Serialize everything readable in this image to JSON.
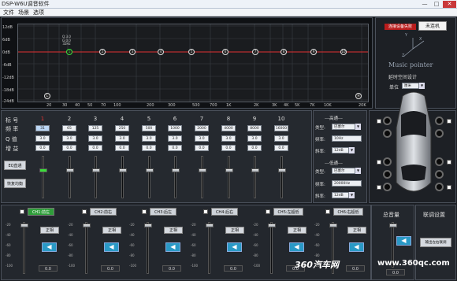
{
  "window": {
    "title": "DSP-W6U调音软件",
    "min": "—",
    "max": "□",
    "close": "✕"
  },
  "menu": [
    "文件",
    "场景",
    "选项"
  ],
  "eq": {
    "y_labels": [
      "12dB",
      "6dB",
      "0dB",
      "-6dB",
      "-12dB",
      "-18dB",
      "-24dB"
    ],
    "x_labels": [
      "20",
      "30",
      "40",
      "50",
      "70",
      "100",
      "200",
      "300",
      "500",
      "700",
      "1K",
      "2K",
      "3K",
      "4K",
      "5K",
      "7K",
      "10K",
      "20K"
    ],
    "bands": [
      "1",
      "2",
      "3",
      "4",
      "5",
      "6",
      "7",
      "8",
      "9",
      "10"
    ],
    "selected_band": "1",
    "info": [
      "Q:3.0",
      "G:0.0",
      "32Hz"
    ],
    "left_node": "L",
    "right_node": "H",
    "curve_color": "#e03030"
  },
  "right": {
    "disconnected": "连接设备失败",
    "not_connected": "未连机",
    "brand": "Music pointer",
    "delay_design": "延时空间设计",
    "unit_label": "单位",
    "unit_value": "厘米",
    "axes": {
      "x": "X",
      "y": "Y",
      "z": "Z"
    }
  },
  "ctrl": {
    "row_labels": [
      "标 号",
      "频 率",
      "Q 值",
      "增 益"
    ],
    "freqs": [
      "31",
      "65",
      "125",
      "250",
      "500",
      "1000",
      "2000",
      "4000",
      "8000",
      "16000"
    ],
    "q": [
      "3.0",
      "3.0",
      "3.0",
      "3.0",
      "3.0",
      "3.0",
      "3.0",
      "3.0",
      "3.0",
      "3.0"
    ],
    "gain": [
      "0.0",
      "0.0",
      "0.0",
      "0.0",
      "0.0",
      "0.0",
      "0.0",
      "0.0",
      "0.0",
      "0.0"
    ],
    "btn_bypass": "EQ直通",
    "btn_reset": "恢复均衡"
  },
  "filter": {
    "high_title": "---高通---",
    "low_title": "---低通---",
    "type_label": "类型:",
    "freq_label": "频率:",
    "slope_label": "斜率:",
    "high_type": "巴塞尔",
    "high_freq": "10Hz",
    "high_slope": "12dB",
    "low_type": "巴塞尔",
    "low_freq": "20000Hz",
    "low_slope": "12dB"
  },
  "channels": [
    {
      "label": "CH1:前左",
      "active": true,
      "group": "正相",
      "value": "0.0"
    },
    {
      "label": "CH2:前右",
      "active": false,
      "group": "正相",
      "value": "0.0"
    },
    {
      "label": "CH3:后左",
      "active": false,
      "group": "正相",
      "value": "0.0"
    },
    {
      "label": "CH4:后右",
      "active": false,
      "group": "正相",
      "value": "0.0"
    },
    {
      "label": "CH5:左超低",
      "active": false,
      "group": "正相",
      "value": "0.0"
    },
    {
      "label": "CH6:右超低",
      "active": false,
      "group": "正相",
      "value": "0.0"
    }
  ],
  "db_scale": [
    "-20",
    "-40",
    "-60",
    "-80",
    "-100"
  ],
  "master": {
    "title": "总音量",
    "value": "0.0"
  },
  "link": {
    "title": "联调设置",
    "button": "输出左右联调"
  },
  "watermark": {
    "brand": "360汽车网",
    "url": "www.360qc.com"
  }
}
